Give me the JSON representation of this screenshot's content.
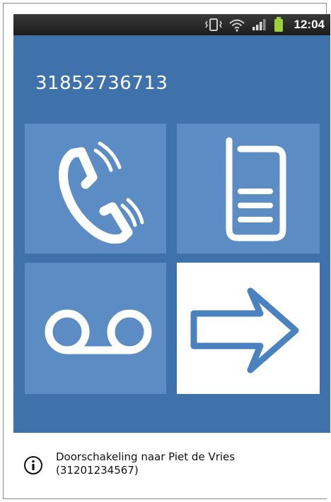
{
  "status_bar": {
    "time": "12:04",
    "icons": [
      "vibrate-icon",
      "wifi-icon",
      "signal-icon",
      "battery-icon"
    ]
  },
  "call": {
    "number": "31852736713"
  },
  "tiles": [
    {
      "icon": "phone-handset-icon",
      "active": false
    },
    {
      "icon": "mobile-phone-icon",
      "active": false
    },
    {
      "icon": "voicemail-icon",
      "active": false
    },
    {
      "icon": "forward-arrow-icon",
      "active": true
    }
  ],
  "info": {
    "line1": "Doorschakeling naar Piet de Vries",
    "line2": "(31201234567)"
  },
  "colors": {
    "background": "#3f72ab",
    "tile": "#5b8cc3",
    "tile_active": "#ffffff",
    "status_bar": "#232323",
    "battery": "#9bd23c"
  }
}
